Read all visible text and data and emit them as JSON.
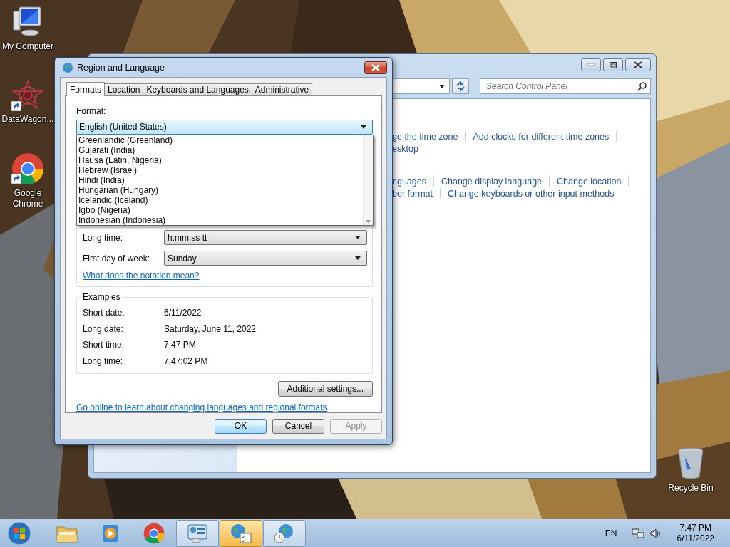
{
  "desktop_icons": [
    {
      "label": "My Computer",
      "kind": "computer",
      "shortcut": false
    },
    {
      "label": "DataWagon...",
      "kind": "star",
      "shortcut": true
    },
    {
      "label": "Google Chrome",
      "kind": "chrome",
      "shortcut": true
    },
    {
      "label": "Recycle Bin",
      "kind": "bin",
      "shortcut": false
    }
  ],
  "control_panel": {
    "search": {
      "placeholder": "Search Control Panel"
    },
    "link_rows": [
      {
        "links": [
          "ge the time zone",
          "Add clocks for different time zones"
        ],
        "trailing_separator": true
      },
      {
        "links": [
          "esktop"
        ],
        "trailing_separator": false
      },
      {
        "links": [
          "nguages",
          "Change display language",
          "Change location"
        ],
        "trailing_separator": true
      },
      {
        "links": [
          "ber format",
          "Change keyboards or other input methods"
        ],
        "trailing_separator": false
      }
    ]
  },
  "dialog": {
    "title": "Region and Language",
    "tabs": [
      {
        "label": "Formats",
        "selected": true
      },
      {
        "label": "Location",
        "selected": false
      },
      {
        "label": "Keyboards and Languages",
        "selected": false
      },
      {
        "label": "Administrative",
        "selected": false
      }
    ],
    "format_label": "Format:",
    "format_value": "English (United States)",
    "format_options": [
      "Greenlandic (Greenland)",
      "Gujarati (India)",
      "Hausa (Latin, Nigeria)",
      "Hebrew (Israel)",
      "Hindi (India)",
      "Hungarian (Hungary)",
      "Icelandic (Iceland)",
      "Igbo (Nigeria)",
      "Indonesian (Indonesia)"
    ],
    "format_rows": [
      {
        "label": "Long time:",
        "value": "h:mm:ss tt"
      },
      {
        "label": "First day of week:",
        "value": "Sunday"
      }
    ],
    "notation_link": "What does the notation mean?",
    "examples": {
      "title": "Examples",
      "rows": [
        {
          "label": "Short date:",
          "value": "6/11/2022"
        },
        {
          "label": "Long date:",
          "value": "Saturday, June 11, 2022"
        },
        {
          "label": "Short time:",
          "value": "7:47 PM"
        },
        {
          "label": "Long time:",
          "value": "7:47:02 PM"
        }
      ]
    },
    "additional_button": "Additional settings...",
    "online_link": "Go online to learn about changing languages and regional formats",
    "buttons": [
      {
        "label": "OK",
        "default": true,
        "disabled": false
      },
      {
        "label": "Cancel",
        "default": false,
        "disabled": false
      },
      {
        "label": "Apply",
        "default": false,
        "disabled": true
      }
    ]
  },
  "taskbar": {
    "apps": [
      {
        "kind": "folder",
        "running": false,
        "active": false
      },
      {
        "kind": "media",
        "running": false,
        "active": false
      },
      {
        "kind": "chrome",
        "running": false,
        "active": false
      },
      {
        "kind": "panel",
        "running": true,
        "active": false
      },
      {
        "kind": "globe-list",
        "running": true,
        "active": true
      },
      {
        "kind": "globe-clock",
        "running": true,
        "active": false
      }
    ],
    "language": "EN",
    "time": "7:47 PM",
    "date": "6/11/2022"
  }
}
